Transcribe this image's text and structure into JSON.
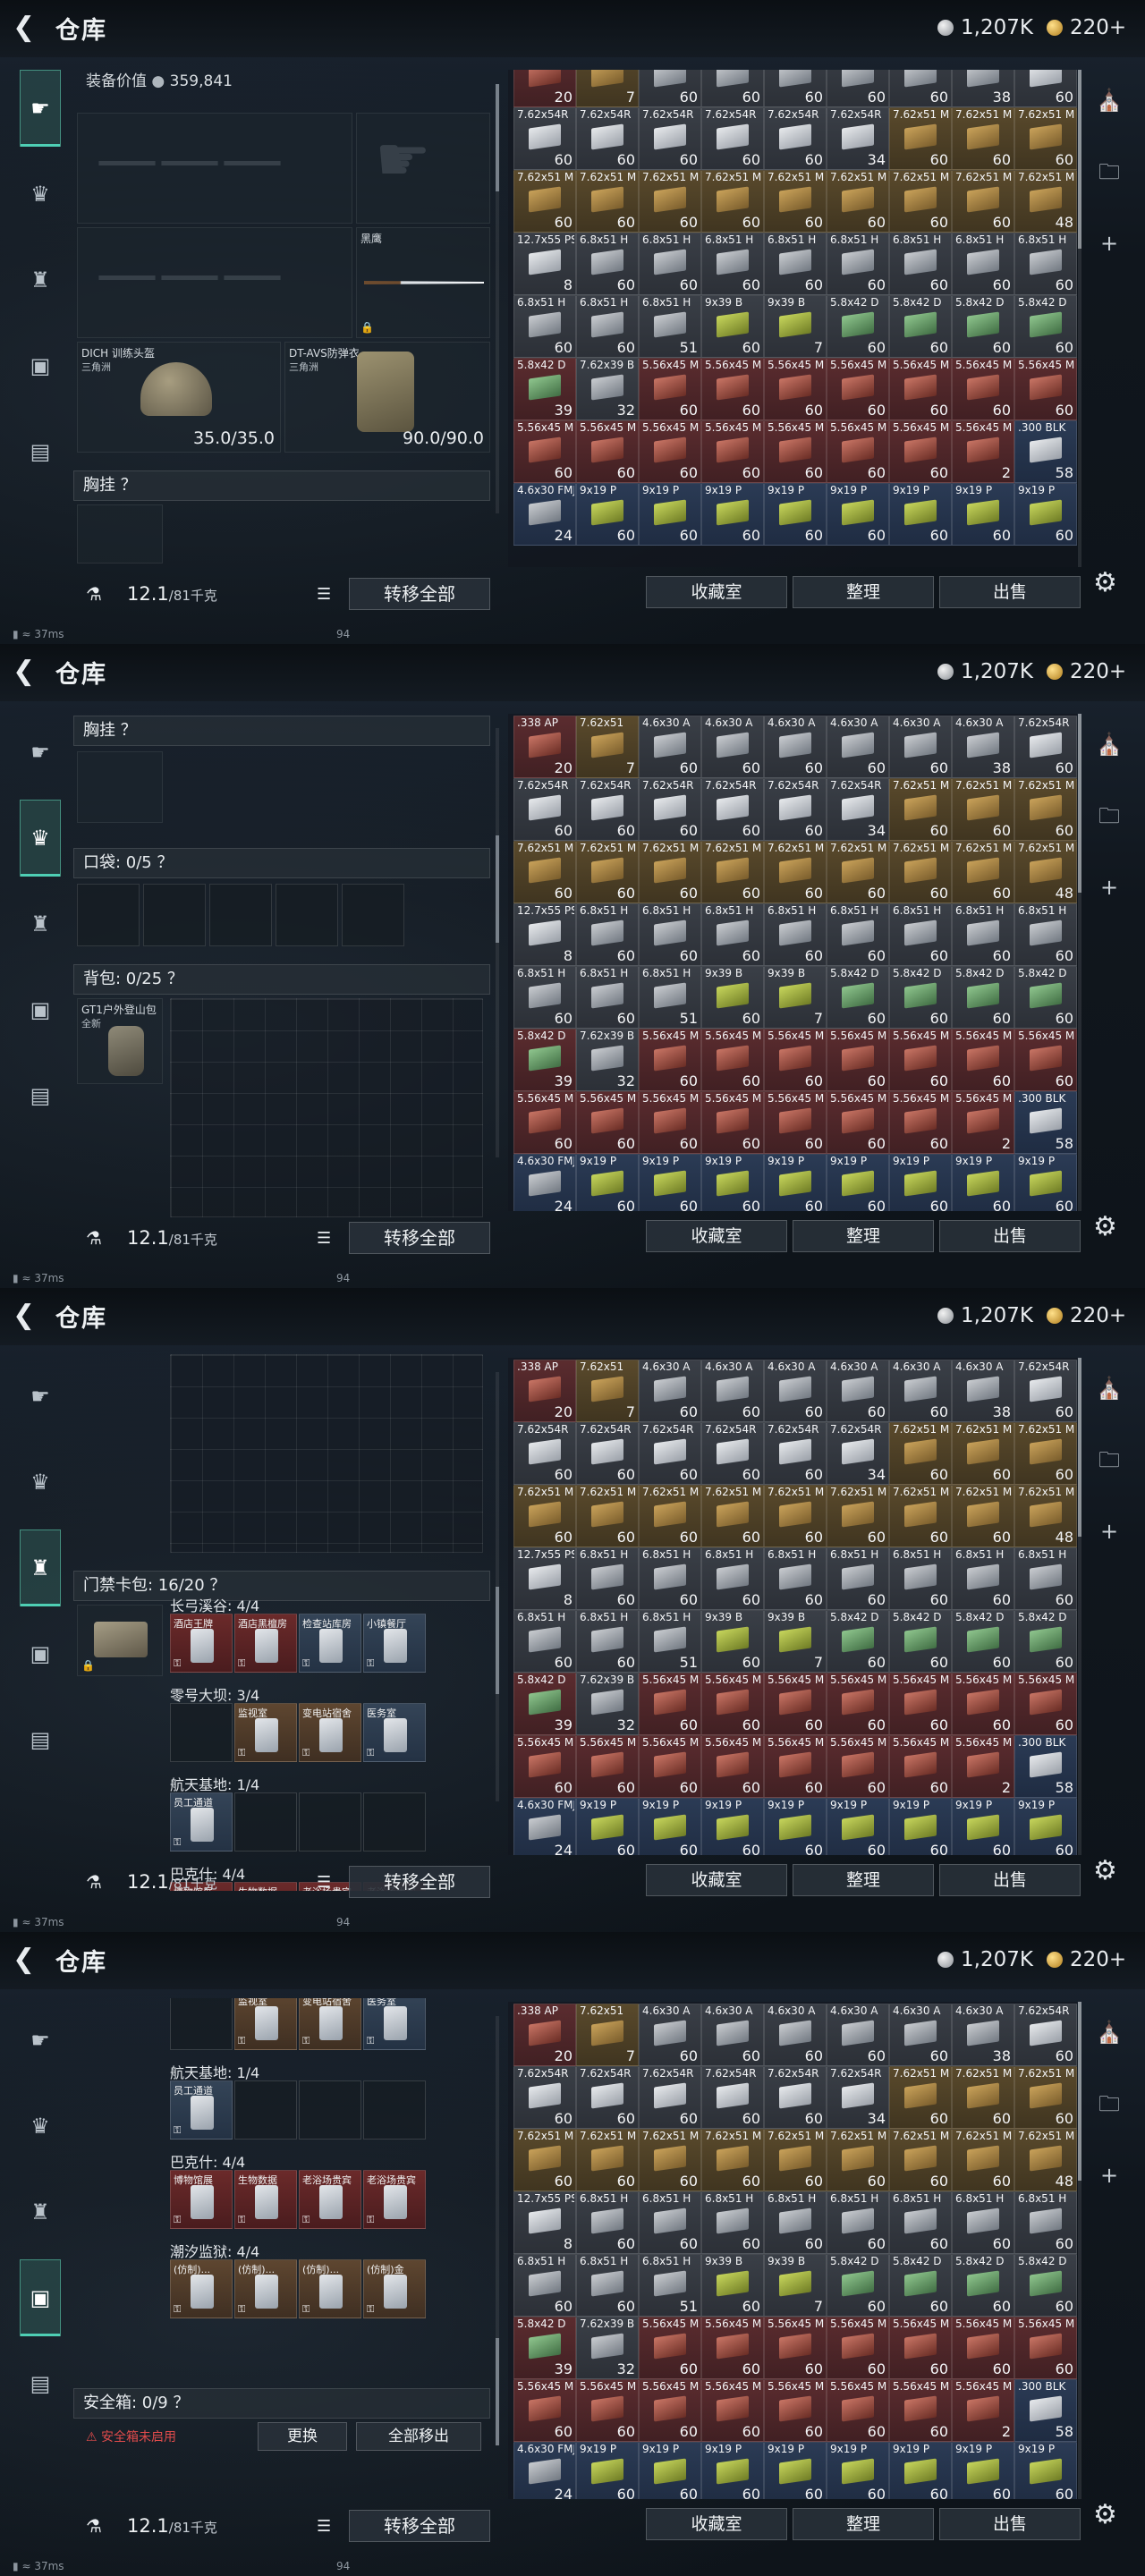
{
  "app": {
    "title": "仓库",
    "silver": "1,207K",
    "gold": "220+"
  },
  "nav": {
    "items": [
      "gun-icon",
      "vest-icon",
      "backpack-icon",
      "card-icon",
      "case-icon"
    ]
  },
  "loadout": {
    "equip_value_label": "装备价值",
    "equip_value": "359,841",
    "knife_label": "黑鹰",
    "helmet_name": "DICH 训练头盔",
    "helmet_sub": "三角洲",
    "helmet_durability": "35.0/35.0",
    "armor_name": "DT-AVS防弹衣",
    "armor_sub": "三角洲",
    "armor_durability": "90.0/90.0",
    "chest_rig": "胸挂 ？",
    "pocket": "口袋: 0/5 ？",
    "backpack": "背包: 0/25 ？",
    "backpack_item": "GT1户外登山包",
    "backpack_item_sub": "全新",
    "keycard_bag": "门禁卡包: 16/20 ？",
    "safe_box": "安全箱: 0/9 ？",
    "safe_warning": "安全箱未启用",
    "replace_btn": "更换",
    "remove_all_btn": "全部移出"
  },
  "keycards": {
    "rows": [
      {
        "label": "长弓溪谷: 4/4",
        "cards": [
          {
            "name": "酒店王牌",
            "color": "red"
          },
          {
            "name": "酒店黑檀房",
            "color": "red"
          },
          {
            "name": "检查站库房",
            "color": "blue"
          },
          {
            "name": "小镇餐厅",
            "color": "blue"
          }
        ]
      },
      {
        "label": "零号大坝: 3/4",
        "cards": [
          {
            "name": "",
            "color": "empty"
          },
          {
            "name": "监视室",
            "color": "brown"
          },
          {
            "name": "变电站宿舍",
            "color": "brown"
          },
          {
            "name": "医务室",
            "color": "blue"
          }
        ]
      },
      {
        "label": "航天基地: 1/4",
        "cards": [
          {
            "name": "员工通道",
            "color": "blue"
          },
          {
            "name": "",
            "color": "empty"
          },
          {
            "name": "",
            "color": "empty"
          },
          {
            "name": "",
            "color": "empty"
          }
        ]
      },
      {
        "label": "巴克什: 4/4",
        "cards": [
          {
            "name": "博物馆展",
            "color": "red"
          },
          {
            "name": "生物数据",
            "color": "red"
          },
          {
            "name": "老浴场贵宾",
            "color": "red"
          },
          {
            "name": "老浴场贵宾",
            "color": "red"
          }
        ]
      },
      {
        "label": "潮汐监狱: 4/4",
        "cards": [
          {
            "name": "(仿制)...",
            "color": "brown"
          },
          {
            "name": "(仿制)...",
            "color": "brown"
          },
          {
            "name": "(仿制)...",
            "color": "brown"
          },
          {
            "name": "(仿制)金",
            "color": "brown"
          }
        ]
      }
    ]
  },
  "weight": {
    "value": "12.1",
    "unit": "/81千克",
    "transfer_all": "转移全部"
  },
  "stash_buttons": {
    "collection": "收藏室",
    "sort": "整理",
    "sell": "出售"
  },
  "stash": {
    "row0": [
      {
        "n": ".338 AP",
        "c": "20",
        "t": "red",
        "b": "c-red"
      },
      {
        "n": "7.62x51",
        "c": "7",
        "t": "gold",
        "b": "c-tan"
      },
      {
        "n": "4.6x30 A",
        "c": "60",
        "t": "gray",
        "b": "c-grey"
      },
      {
        "n": "4.6x30 A",
        "c": "60",
        "t": "gray",
        "b": "c-grey"
      },
      {
        "n": "4.6x30 A",
        "c": "60",
        "t": "gray",
        "b": "c-grey"
      },
      {
        "n": "4.6x30 A",
        "c": "60",
        "t": "gray",
        "b": "c-grey"
      },
      {
        "n": "4.6x30 A",
        "c": "60",
        "t": "gray",
        "b": "c-grey"
      },
      {
        "n": "4.6x30 A",
        "c": "38",
        "t": "gray",
        "b": "c-grey"
      },
      {
        "n": "7.62x54R",
        "c": "60",
        "t": "gray",
        "b": "c-white"
      }
    ],
    "row1": [
      {
        "n": "7.62x54R",
        "c": "60",
        "t": "gray",
        "b": "c-white"
      },
      {
        "n": "7.62x54R",
        "c": "60",
        "t": "gray",
        "b": "c-white"
      },
      {
        "n": "7.62x54R",
        "c": "60",
        "t": "gray",
        "b": "c-white"
      },
      {
        "n": "7.62x54R",
        "c": "60",
        "t": "gray",
        "b": "c-white"
      },
      {
        "n": "7.62x54R",
        "c": "60",
        "t": "gray",
        "b": "c-white"
      },
      {
        "n": "7.62x54R",
        "c": "34",
        "t": "gray",
        "b": "c-white"
      },
      {
        "n": "7.62x51 M",
        "c": "60",
        "t": "gold",
        "b": "c-tan"
      },
      {
        "n": "7.62x51 M",
        "c": "60",
        "t": "gold",
        "b": "c-tan"
      },
      {
        "n": "7.62x51 M",
        "c": "60",
        "t": "gold",
        "b": "c-tan"
      }
    ],
    "row2": [
      {
        "n": "7.62x51 M",
        "c": "60",
        "t": "gold",
        "b": "c-tan"
      },
      {
        "n": "7.62x51 M",
        "c": "60",
        "t": "gold",
        "b": "c-tan"
      },
      {
        "n": "7.62x51 M",
        "c": "60",
        "t": "gold",
        "b": "c-tan"
      },
      {
        "n": "7.62x51 M",
        "c": "60",
        "t": "gold",
        "b": "c-tan"
      },
      {
        "n": "7.62x51 M",
        "c": "60",
        "t": "gold",
        "b": "c-tan"
      },
      {
        "n": "7.62x51 M",
        "c": "60",
        "t": "gold",
        "b": "c-tan"
      },
      {
        "n": "7.62x51 M",
        "c": "60",
        "t": "gold",
        "b": "c-tan"
      },
      {
        "n": "7.62x51 M",
        "c": "60",
        "t": "gold",
        "b": "c-tan"
      },
      {
        "n": "7.62x51 M",
        "c": "48",
        "t": "gold",
        "b": "c-tan"
      }
    ],
    "row3": [
      {
        "n": "12.7x55 PS",
        "c": "8",
        "t": "gray",
        "b": "c-white"
      },
      {
        "n": "6.8x51 H",
        "c": "60",
        "t": "gray",
        "b": "c-grey"
      },
      {
        "n": "6.8x51 H",
        "c": "60",
        "t": "gray",
        "b": "c-grey"
      },
      {
        "n": "6.8x51 H",
        "c": "60",
        "t": "gray",
        "b": "c-grey"
      },
      {
        "n": "6.8x51 H",
        "c": "60",
        "t": "gray",
        "b": "c-grey"
      },
      {
        "n": "6.8x51 H",
        "c": "60",
        "t": "gray",
        "b": "c-grey"
      },
      {
        "n": "6.8x51 H",
        "c": "60",
        "t": "gray",
        "b": "c-grey"
      },
      {
        "n": "6.8x51 H",
        "c": "60",
        "t": "gray",
        "b": "c-grey"
      },
      {
        "n": "6.8x51 H",
        "c": "60",
        "t": "gray",
        "b": "c-grey"
      }
    ],
    "row4": [
      {
        "n": "6.8x51 H",
        "c": "60",
        "t": "gray",
        "b": "c-grey"
      },
      {
        "n": "6.8x51 H",
        "c": "60",
        "t": "gray",
        "b": "c-grey"
      },
      {
        "n": "6.8x51 H",
        "c": "51",
        "t": "gray",
        "b": "c-grey"
      },
      {
        "n": "9x39 B",
        "c": "60",
        "t": "gray",
        "b": "c-lime"
      },
      {
        "n": "9x39 B",
        "c": "7",
        "t": "gray",
        "b": "c-lime"
      },
      {
        "n": "5.8x42 D",
        "c": "60",
        "t": "gray",
        "b": "c-green"
      },
      {
        "n": "5.8x42 D",
        "c": "60",
        "t": "gray",
        "b": "c-green"
      },
      {
        "n": "5.8x42 D",
        "c": "60",
        "t": "gray",
        "b": "c-green"
      },
      {
        "n": "5.8x42 D",
        "c": "60",
        "t": "gray",
        "b": "c-green"
      }
    ],
    "row5": [
      {
        "n": "5.8x42 D",
        "c": "39",
        "t": "red",
        "b": "c-green"
      },
      {
        "n": "7.62x39 B",
        "c": "32",
        "t": "gray",
        "b": "c-grey"
      },
      {
        "n": "5.56x45 M",
        "c": "60",
        "t": "red",
        "b": "c-red"
      },
      {
        "n": "5.56x45 M",
        "c": "60",
        "t": "red",
        "b": "c-red"
      },
      {
        "n": "5.56x45 M",
        "c": "60",
        "t": "red",
        "b": "c-red"
      },
      {
        "n": "5.56x45 M",
        "c": "60",
        "t": "red",
        "b": "c-red"
      },
      {
        "n": "5.56x45 M",
        "c": "60",
        "t": "red",
        "b": "c-red"
      },
      {
        "n": "5.56x45 M",
        "c": "60",
        "t": "red",
        "b": "c-red"
      },
      {
        "n": "5.56x45 M",
        "c": "60",
        "t": "red",
        "b": "c-red"
      }
    ],
    "row6": [
      {
        "n": "5.56x45 M",
        "c": "60",
        "t": "red",
        "b": "c-red"
      },
      {
        "n": "5.56x45 M",
        "c": "60",
        "t": "red",
        "b": "c-red"
      },
      {
        "n": "5.56x45 M",
        "c": "60",
        "t": "red",
        "b": "c-red"
      },
      {
        "n": "5.56x45 M",
        "c": "60",
        "t": "red",
        "b": "c-red"
      },
      {
        "n": "5.56x45 M",
        "c": "60",
        "t": "red",
        "b": "c-red"
      },
      {
        "n": "5.56x45 M",
        "c": "60",
        "t": "red",
        "b": "c-red"
      },
      {
        "n": "5.56x45 M",
        "c": "60",
        "t": "red",
        "b": "c-red"
      },
      {
        "n": "5.56x45 M",
        "c": "2",
        "t": "red",
        "b": "c-red"
      },
      {
        "n": ".300 BLK",
        "c": "58",
        "t": "blue",
        "b": "c-white"
      }
    ],
    "row7": [
      {
        "n": "4.6x30 FMJ",
        "c": "24",
        "t": "blue",
        "b": "c-grey"
      },
      {
        "n": "9x19 P",
        "c": "60",
        "t": "blue",
        "b": "c-lime"
      },
      {
        "n": "9x19 P",
        "c": "60",
        "t": "blue",
        "b": "c-lime"
      },
      {
        "n": "9x19 P",
        "c": "60",
        "t": "blue",
        "b": "c-lime"
      },
      {
        "n": "9x19 P",
        "c": "60",
        "t": "blue",
        "b": "c-lime"
      },
      {
        "n": "9x19 P",
        "c": "60",
        "t": "blue",
        "b": "c-lime"
      },
      {
        "n": "9x19 P",
        "c": "60",
        "t": "blue",
        "b": "c-lime"
      },
      {
        "n": "9x19 P",
        "c": "60",
        "t": "blue",
        "b": "c-lime"
      },
      {
        "n": "9x19 P",
        "c": "60",
        "t": "blue",
        "b": "c-lime"
      }
    ]
  },
  "status": {
    "ping": "37ms",
    "fps": "94"
  }
}
